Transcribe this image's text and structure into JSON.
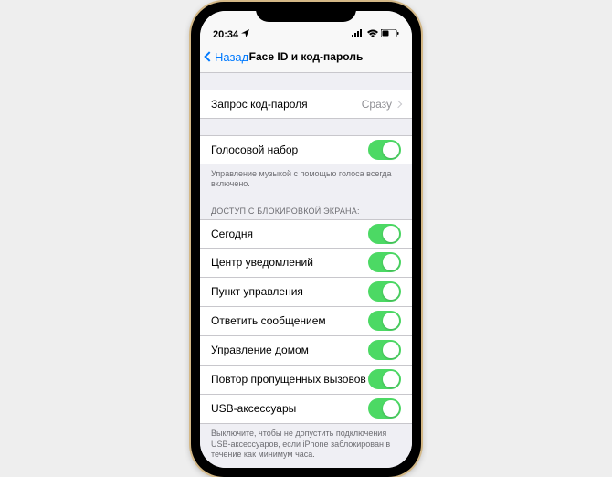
{
  "status": {
    "time": "20:34"
  },
  "nav": {
    "back": "Назад",
    "title": "Face ID и код-пароль"
  },
  "passcode_request": {
    "label": "Запрос код-пароля",
    "value": "Сразу"
  },
  "voice_dial": {
    "label": "Голосовой набор",
    "footer": "Управление музыкой с помощью голоса всегда включено."
  },
  "lock_access": {
    "header": "ДОСТУП С БЛОКИРОВКОЙ ЭКРАНА:",
    "items": [
      {
        "label": "Сегодня"
      },
      {
        "label": "Центр уведомлений"
      },
      {
        "label": "Пункт управления"
      },
      {
        "label": "Ответить сообщением"
      },
      {
        "label": "Управление домом"
      },
      {
        "label": "Повтор пропущенных вызовов"
      },
      {
        "label": "USB-аксессуары"
      }
    ],
    "footer": "Выключите, чтобы не допустить подключения USB-аксессуаров, если iPhone заблокирован в течение как минимум часа."
  }
}
